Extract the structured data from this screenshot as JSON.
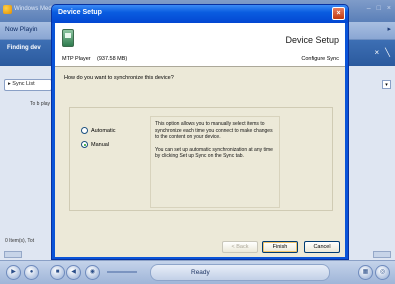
{
  "player": {
    "title": "Windows Media Player",
    "now_playing_tab": "Now Playin",
    "finding_label": "Finding dev",
    "sync_list": "Sync List",
    "side_text": "To b play",
    "items_status": "0 Item(s), Tot",
    "status": "Ready"
  },
  "dialog": {
    "title": "Device Setup",
    "device_name": "MTP Player",
    "device_size": "(937.58 MB)",
    "header_title": "Device Setup",
    "header_subtitle": "Configure Sync",
    "question": "How do you want to synchronize this device?",
    "options": [
      {
        "label": "Automatic",
        "selected": false
      },
      {
        "label": "Manual",
        "selected": true
      }
    ],
    "description_p1": "This option allows you to manually select items to synchronize each time you connect to make changes to the content on your device.",
    "description_p2": "You can set up automatic synchronization at any time by clicking Set up Sync on the Sync tab.",
    "buttons": {
      "back": "< Back",
      "finish": "Finish",
      "cancel": "Cancel"
    }
  }
}
